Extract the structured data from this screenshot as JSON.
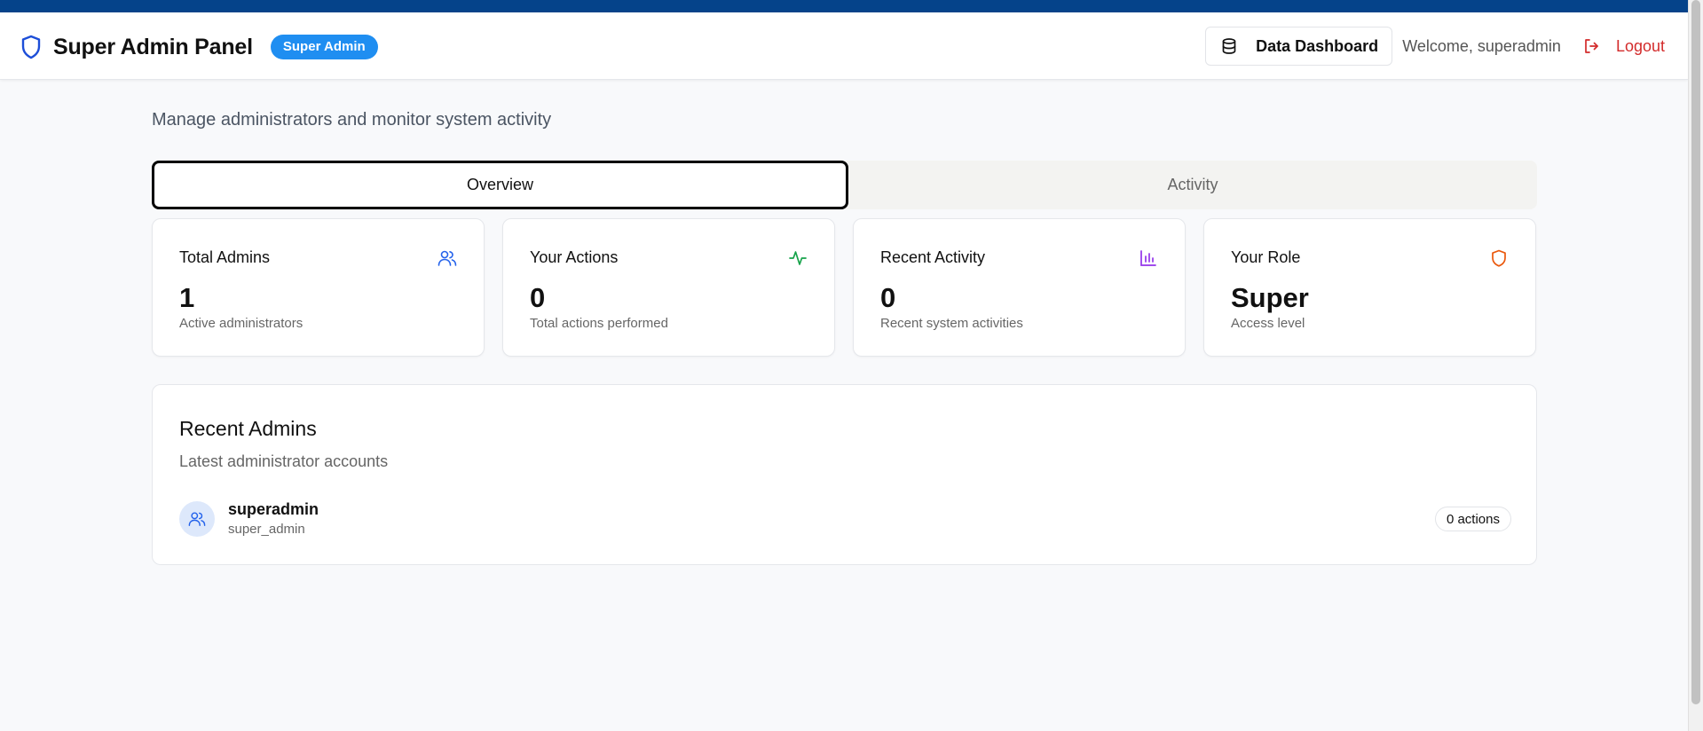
{
  "header": {
    "title": "Super Admin Panel",
    "role_badge": "Super Admin",
    "brand_icon": "shield-icon",
    "dashboard_button": "Data Dashboard",
    "dashboard_icon": "database-icon",
    "welcome": "Welcome, superadmin",
    "logout": "Logout",
    "logout_icon": "logout-icon"
  },
  "page": {
    "subtitle": "Manage administrators and monitor system activity"
  },
  "tabs": [
    {
      "label": "Overview",
      "active": true
    },
    {
      "label": "Activity",
      "active": false
    }
  ],
  "stats": [
    {
      "title": "Total Admins",
      "value": "1",
      "description": "Active administrators",
      "icon": "users-icon",
      "color": "#2563eb"
    },
    {
      "title": "Your Actions",
      "value": "0",
      "description": "Total actions performed",
      "icon": "activity-icon",
      "color": "#16a34a"
    },
    {
      "title": "Recent Activity",
      "value": "0",
      "description": "Recent system activities",
      "icon": "bar-chart-icon",
      "color": "#9333ea"
    },
    {
      "title": "Your Role",
      "value": "Super",
      "description": "Access level",
      "icon": "shield-icon",
      "color": "#ea580c"
    }
  ],
  "recent_admins": {
    "title": "Recent Admins",
    "subtitle": "Latest administrator accounts",
    "items": [
      {
        "name": "superadmin",
        "role": "super_admin",
        "actions": "0 actions",
        "icon": "users-icon"
      }
    ]
  },
  "colors": {
    "topbar": "#05438a",
    "accent": "#1f8ef1",
    "logout": "#d32b2b"
  }
}
